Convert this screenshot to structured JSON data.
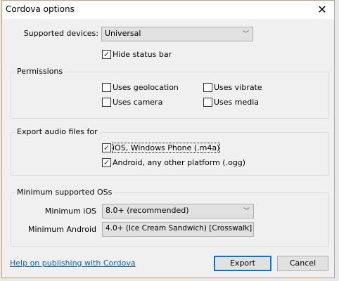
{
  "window": {
    "title": "Cordova options",
    "close_icon": "close-icon"
  },
  "supported_devices": {
    "label": "Supported devices:",
    "value": "Universal"
  },
  "hide_status_bar": {
    "label": "Hide status bar",
    "checked": true
  },
  "permissions": {
    "title": "Permissions",
    "items": [
      {
        "label": "Uses geolocation",
        "checked": false
      },
      {
        "label": "Uses vibrate",
        "checked": false
      },
      {
        "label": "Uses camera",
        "checked": false
      },
      {
        "label": "Uses media",
        "checked": false
      }
    ]
  },
  "export_audio": {
    "title": "Export audio files for",
    "items": [
      {
        "label": "iOS, Windows Phone (.m4a)",
        "checked": true
      },
      {
        "label": "Android, any other platform (.ogg)",
        "checked": true
      }
    ]
  },
  "min_os": {
    "title": "Minimum supported OSs",
    "ios": {
      "label": "Minimum iOS",
      "value": "8.0+ (recommended)"
    },
    "android": {
      "label": "Minimum Android",
      "value": "4.0+ (Ice Cream Sandwich) [Crosswalk]"
    }
  },
  "footer": {
    "help_link": "Help on publishing with Cordova",
    "export": "Export",
    "cancel": "Cancel"
  },
  "colors": {
    "accent": "#0078d7",
    "link": "#0066cc"
  }
}
